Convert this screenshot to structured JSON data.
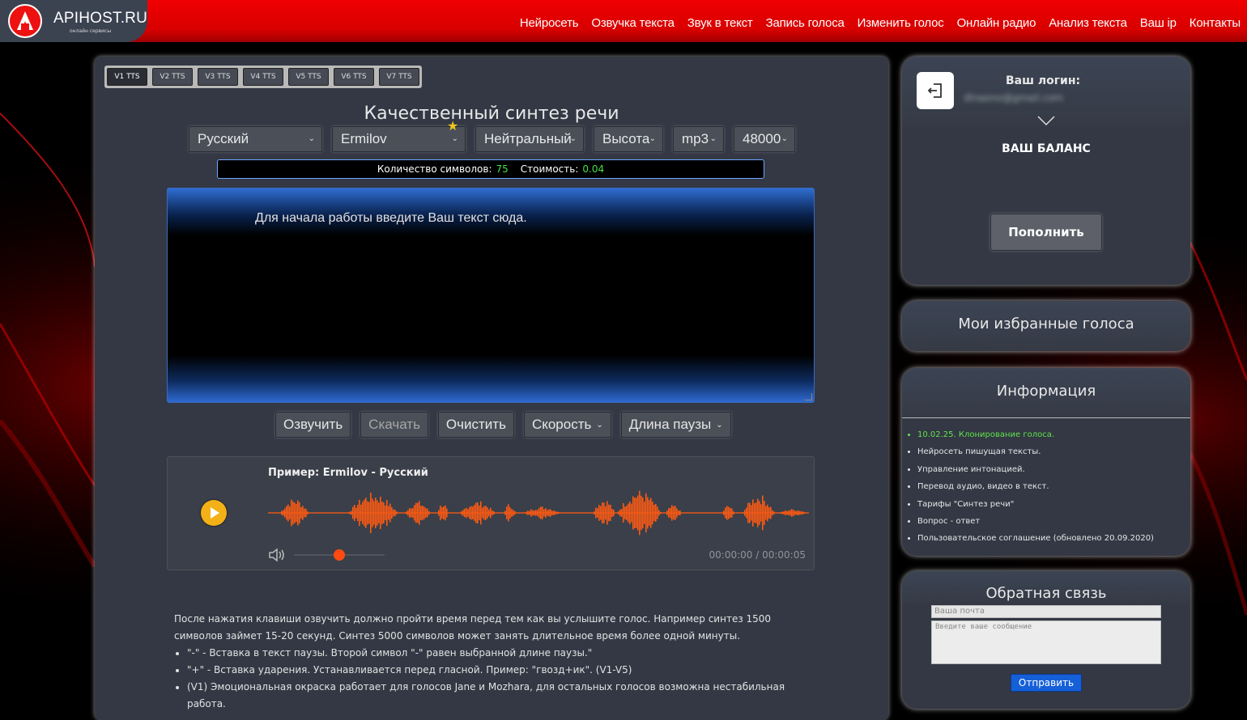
{
  "header": {
    "logo_text": "APIHOST.RU",
    "logo_subtitle": "онлайн сервисы",
    "nav": [
      "Нейросеть",
      "Озвучка текста",
      "Звук в текст",
      "Запись голоса",
      "Изменить голос",
      "Онлайн радио",
      "Анализ текста",
      "Ваш ip",
      "Контакты"
    ]
  },
  "tts_tabs": [
    "V1 TTS",
    "V2 TTS",
    "V3 TTS",
    "V4 TTS",
    "V5 TTS",
    "V6 TTS",
    "V7 TTS"
  ],
  "active_tab": "V1 TTS",
  "title": "Качественный синтез речи",
  "selects": {
    "language": "Русский",
    "voice": "Ermilov",
    "emotion": "Нейтральный",
    "pitch": "Высота",
    "format": "mp3",
    "rate": "48000"
  },
  "counter": {
    "chars_label": "Количество символов:",
    "chars_value": "75",
    "cost_label": "Стоимость:",
    "cost_value": "0.04"
  },
  "textarea": {
    "placeholder": "Для начала работы введите Ваш текст сюда."
  },
  "actions": {
    "speak": "Озвучить",
    "download": "Скачать",
    "clear": "Очистить",
    "speed": "Скорость",
    "pause": "Длина паузы"
  },
  "player": {
    "title": "Пример: Ermilov - Русский",
    "time": "00:00:00 / 00:00:05",
    "volume": 0.5,
    "accent": "#ff5a12",
    "play_color": "#f3b117"
  },
  "info_text": {
    "paragraph": "После нажатия клавиши озвучить должно пройти время перед тем как вы услышите голос. Например синтез 1500 символов займет 15-20 секунд. Синтез 5000 символов может занять длительное время более одной минуты.",
    "bullets": [
      "\"-\" - Вставка в текст паузы. Второй символ \"-\" равен выбранной длине паузы.\"",
      "\"+\" - Вставка ударения. Устанавливается перед гласной. Пример: \"гвозд+ик\". (V1-V5)",
      "(V1) Эмоциональная окраска работает для голосов Jane и Mozhara, для остальных голосов возможна нестабильная работа."
    ]
  },
  "sidebar": {
    "login_label": "Ваш логин:",
    "login_email": "dlnaono@gmail.com",
    "balance_title": "ВАШ БАЛАНС",
    "topup_button": "Пополнить",
    "favorites_title": "Мои избранные голоса",
    "info_title": "Информация",
    "info_items": [
      "10.02.25. Клонирование голоса.",
      "Нейросеть пишущая тексты.",
      "Управление интонацией.",
      "Перевод аудио, видео в текст.",
      "Тарифы \"Синтез речи\"",
      "Вопрос - ответ",
      "Пользовательское соглашение (обновлено 20.09.2020)"
    ],
    "feedback_title": "Обратная связь",
    "feedback_email_placeholder": "Ваша почта",
    "feedback_message_placeholder": "Введите ваше сообщение",
    "feedback_send": "Отправить"
  },
  "colors": {
    "header_red": "#e00000",
    "panel_bg": "#333844",
    "green_text": "#48e048"
  }
}
